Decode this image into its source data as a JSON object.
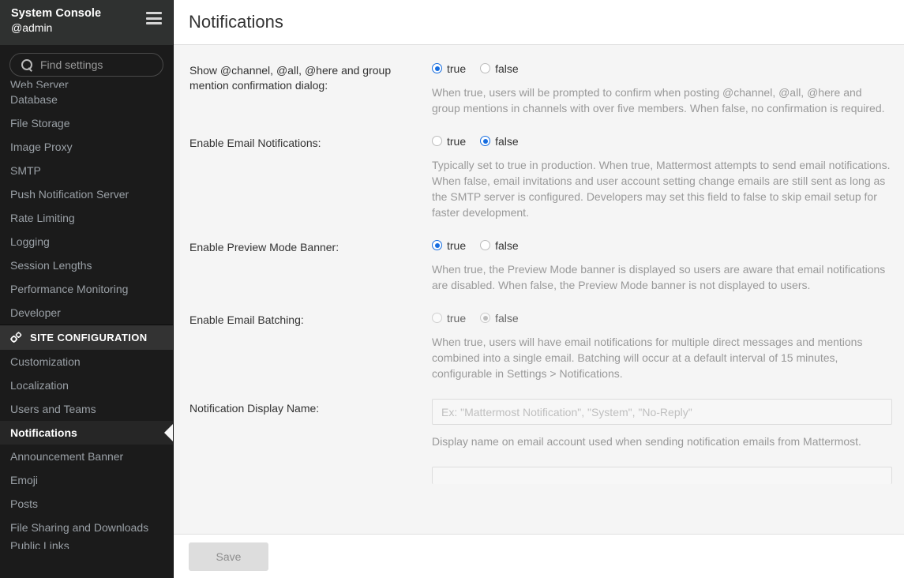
{
  "sidebar": {
    "title": "System Console",
    "user": "@admin",
    "menu_icon": "hamburger-icon",
    "search": {
      "icon": "search-icon",
      "placeholder": "Find settings",
      "value": ""
    },
    "top_items": [
      {
        "label": "Web Server",
        "clipped": true
      },
      {
        "label": "Database"
      },
      {
        "label": "File Storage"
      },
      {
        "label": "Image Proxy"
      },
      {
        "label": "SMTP"
      },
      {
        "label": "Push Notification Server"
      },
      {
        "label": "Rate Limiting"
      },
      {
        "label": "Logging"
      },
      {
        "label": "Session Lengths"
      },
      {
        "label": "Performance Monitoring"
      },
      {
        "label": "Developer"
      }
    ],
    "section": {
      "icon": "gears-icon",
      "label": "SITE CONFIGURATION"
    },
    "section_items": [
      {
        "label": "Customization"
      },
      {
        "label": "Localization"
      },
      {
        "label": "Users and Teams"
      },
      {
        "label": "Notifications",
        "active": true
      },
      {
        "label": "Announcement Banner"
      },
      {
        "label": "Emoji"
      },
      {
        "label": "Posts"
      },
      {
        "label": "File Sharing and Downloads"
      },
      {
        "label": "Public Links",
        "clipped": true
      }
    ],
    "colors": {
      "background": "#1b1b1b",
      "header_background": "#2f3130",
      "section_background": "#333333",
      "active_background": "#262626",
      "item_text": "#9aa0a6",
      "active_text": "#ffffff"
    }
  },
  "header": {
    "title": "Notifications"
  },
  "settings": [
    {
      "id": "show-mention-confirmation",
      "label": "Show @channel, @all, @here and group mention confirmation dialog:",
      "type": "radio",
      "options": [
        {
          "label": "true",
          "value": "true"
        },
        {
          "label": "false",
          "value": "false"
        }
      ],
      "value": "true",
      "disabled": false,
      "help": "When true, users will be prompted to confirm when posting @channel, @all, @here and group mentions in channels with over five members. When false, no confirmation is required."
    },
    {
      "id": "enable-email-notifications",
      "label": "Enable Email Notifications:",
      "type": "radio",
      "options": [
        {
          "label": "true",
          "value": "true"
        },
        {
          "label": "false",
          "value": "false"
        }
      ],
      "value": "false",
      "disabled": false,
      "help": "Typically set to true in production. When true, Mattermost attempts to send email notifications. When false, email invitations and user account setting change emails are still sent as long as the SMTP server is configured. Developers may set this field to false to skip email setup for faster development."
    },
    {
      "id": "enable-preview-mode-banner",
      "label": "Enable Preview Mode Banner:",
      "type": "radio",
      "options": [
        {
          "label": "true",
          "value": "true"
        },
        {
          "label": "false",
          "value": "false"
        }
      ],
      "value": "true",
      "disabled": false,
      "help": "When true, the Preview Mode banner is displayed so users are aware that email notifications are disabled. When false, the Preview Mode banner is not displayed to users."
    },
    {
      "id": "enable-email-batching",
      "label": "Enable Email Batching:",
      "type": "radio",
      "options": [
        {
          "label": "true",
          "value": "true"
        },
        {
          "label": "false",
          "value": "false"
        }
      ],
      "value": "false",
      "disabled": true,
      "help": "When true, users will have email notifications for multiple direct messages and mentions combined into a single email. Batching will occur at a default interval of 15 minutes, configurable in Settings > Notifications."
    },
    {
      "id": "notification-display-name",
      "label": "Notification Display Name:",
      "type": "text",
      "value": "",
      "placeholder": "Ex: \"Mattermost Notification\", \"System\", \"No-Reply\"",
      "disabled": false,
      "help": "Display name on email account used when sending notification emails from Mattermost."
    }
  ],
  "save_bar": {
    "save_label": "Save",
    "save_disabled": true
  },
  "colors": {
    "accent": "#166de0",
    "page_background": "#f5f5f5",
    "panel_background": "#ffffff",
    "help_text": "#999999",
    "label_text": "#333333"
  }
}
